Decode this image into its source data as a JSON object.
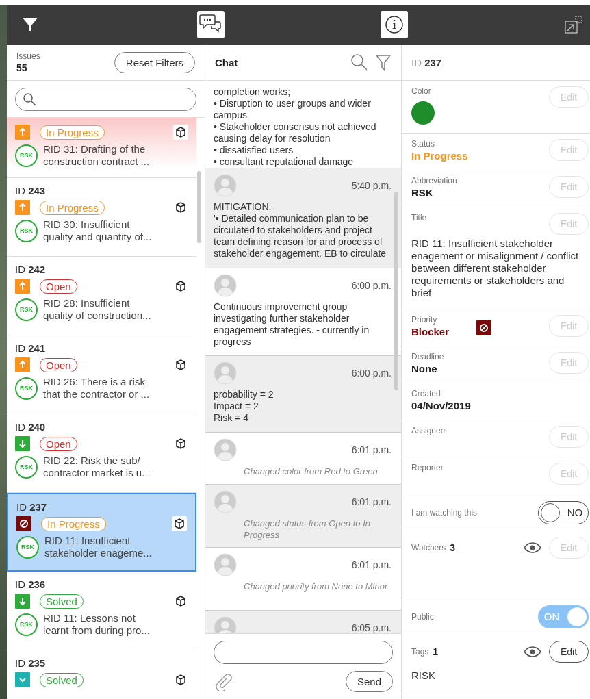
{
  "toolbar": {
    "tabs": [
      {
        "kind": "filter",
        "selected": false
      },
      {
        "kind": "chat",
        "selected": true
      },
      {
        "kind": "info",
        "selected": true
      },
      {
        "kind": "expand",
        "selected": false
      }
    ]
  },
  "issues": {
    "label": "Issues",
    "count": "55",
    "reset_button": "Reset Filters",
    "items": [
      {
        "priority": {
          "kind": "major"
        },
        "status": {
          "kind": "in_progress",
          "label": "In Progress"
        },
        "abbreviation": "RSK",
        "title": [
          "RID 31: Drafting of the",
          "construction contract ..."
        ],
        "highlighted": true,
        "selected": false
      },
      {
        "id_label": "ID",
        "id": "243",
        "priority": {
          "kind": "major"
        },
        "status": {
          "kind": "in_progress",
          "label": "In Progress"
        },
        "abbreviation": "RSK",
        "title": [
          "RID 30: Insufficient",
          "quality and quantity of..."
        ],
        "highlighted": false,
        "selected": false
      },
      {
        "id_label": "ID",
        "id": "242",
        "priority": {
          "kind": "major"
        },
        "status": {
          "kind": "open",
          "label": "Open"
        },
        "abbreviation": "RSK",
        "title": [
          "RID 28: Insufficient",
          "quality of construction..."
        ],
        "highlighted": false,
        "selected": false
      },
      {
        "id_label": "ID",
        "id": "241",
        "priority": {
          "kind": "major"
        },
        "status": {
          "kind": "open",
          "label": "Open"
        },
        "abbreviation": "RSK",
        "title": [
          "RID 26: There is a risk",
          "that the contractor or ..."
        ],
        "highlighted": false,
        "selected": false
      },
      {
        "id_label": "ID",
        "id": "240",
        "priority": {
          "kind": "minor"
        },
        "status": {
          "kind": "open",
          "label": "Open"
        },
        "abbreviation": "RSK",
        "title": [
          "RID 22: Risk the sub/",
          "contractor market is u..."
        ],
        "highlighted": false,
        "selected": false
      },
      {
        "id_label": "ID",
        "id": "237",
        "priority": {
          "kind": "blocker"
        },
        "status": {
          "kind": "in_progress",
          "label": "In Progress"
        },
        "abbreviation": "RSK",
        "title": [
          "RID 11: Insufficient",
          "stakeholder enageme..."
        ],
        "highlighted": false,
        "selected": true
      },
      {
        "id_label": "ID",
        "id": "236",
        "priority": {
          "kind": "minor"
        },
        "status": {
          "kind": "solved",
          "label": "Solved"
        },
        "abbreviation": "RSK",
        "title": [
          "RID 11: Lessons not",
          "learnt from during pro..."
        ],
        "highlighted": false,
        "selected": false
      },
      {
        "id_label": "ID",
        "id": "235",
        "priority": {
          "kind": "trivial"
        },
        "status": {
          "kind": "solved",
          "label": "Solved"
        },
        "highlighted": false,
        "selected": false
      }
    ]
  },
  "chat": {
    "title": "Chat",
    "messages": [
      {
        "kind": "text",
        "text": "completion works;\n• Disruption to user groups and wider campus\n• Stakeholder consensus not achieved causing delay for resolution\n• dissatisfied users\n• consultant reputational damage"
      },
      {
        "kind": "text",
        "time": "5:40 p.m.",
        "text": "MITIGATION:\n'• Detailed communication plan to be circulated to stakeholders and project team defining reason for and process of stakeholder engagement. EB to circulate"
      },
      {
        "kind": "text",
        "time": "6:00 p.m.",
        "text": "Continuous improvement group investigating further stakeholder engagement strategies. - currently in progress"
      },
      {
        "kind": "text",
        "time": "6:00 p.m.",
        "text": "probability = 2\nImpact = 2\nRisk = 4"
      },
      {
        "kind": "event",
        "time": "6:01 p.m.",
        "text": "Changed color from Red to Green"
      },
      {
        "kind": "event",
        "time": "6:01 p.m.",
        "text": "Changed status from Open to In Progress"
      },
      {
        "kind": "event",
        "time": "6:01 p.m.",
        "text": "Changed priority from None to Minor"
      },
      {
        "time": "6:05 p.m."
      }
    ],
    "send_button": "Send"
  },
  "details": {
    "id_label": "ID",
    "id": "237",
    "fields": [
      {
        "kind": "color",
        "label": "Color",
        "color": "#1e8e2a",
        "edit": {
          "label": "Edit",
          "disabled": true
        }
      },
      {
        "kind": "status",
        "label": "Status",
        "value": "In Progress",
        "status": {
          "kind": "in_progress"
        },
        "edit": {
          "label": "Edit",
          "disabled": true
        }
      },
      {
        "kind": "text",
        "label": "Abbreviation",
        "value": "RSK",
        "edit": {
          "label": "Edit",
          "disabled": true
        }
      },
      {
        "kind": "title",
        "label": "Title",
        "value": "RID 11: Insufficient stakeholder enagement or misalignment / conflict between different stakeholder requirements or stakeholders and brief",
        "edit": {
          "label": "Edit",
          "disabled": true
        }
      },
      {
        "kind": "priority",
        "label": "Priority",
        "value": "Blocker",
        "priority": {
          "kind": "blocker"
        },
        "edit": {
          "label": "Edit",
          "disabled": true
        }
      },
      {
        "kind": "text",
        "label": "Deadline",
        "value": "None",
        "edit": {
          "label": "Edit",
          "disabled": true
        }
      },
      {
        "kind": "text",
        "label": "Created",
        "value": "04/Nov/2019"
      },
      {
        "kind": "text",
        "label": "Assignee",
        "edit": {
          "label": "Edit",
          "disabled": true
        }
      },
      {
        "kind": "text",
        "label": "Reporter",
        "edit": {
          "label": "Edit",
          "disabled": true
        }
      },
      {
        "kind": "toggle",
        "label": "I am watching this",
        "on": false,
        "toggle_label": "NO"
      },
      {
        "kind": "watchers",
        "label": "Watchers",
        "count": "3",
        "edit": {
          "label": "Edit",
          "disabled": true
        }
      },
      {
        "kind": "toggle",
        "label": "Public",
        "on": true,
        "toggle_label": "ON"
      },
      {
        "kind": "tags",
        "label": "Tags",
        "count": "1",
        "value": "RISK",
        "edit": {
          "label": "Edit",
          "disabled": false
        }
      }
    ]
  }
}
